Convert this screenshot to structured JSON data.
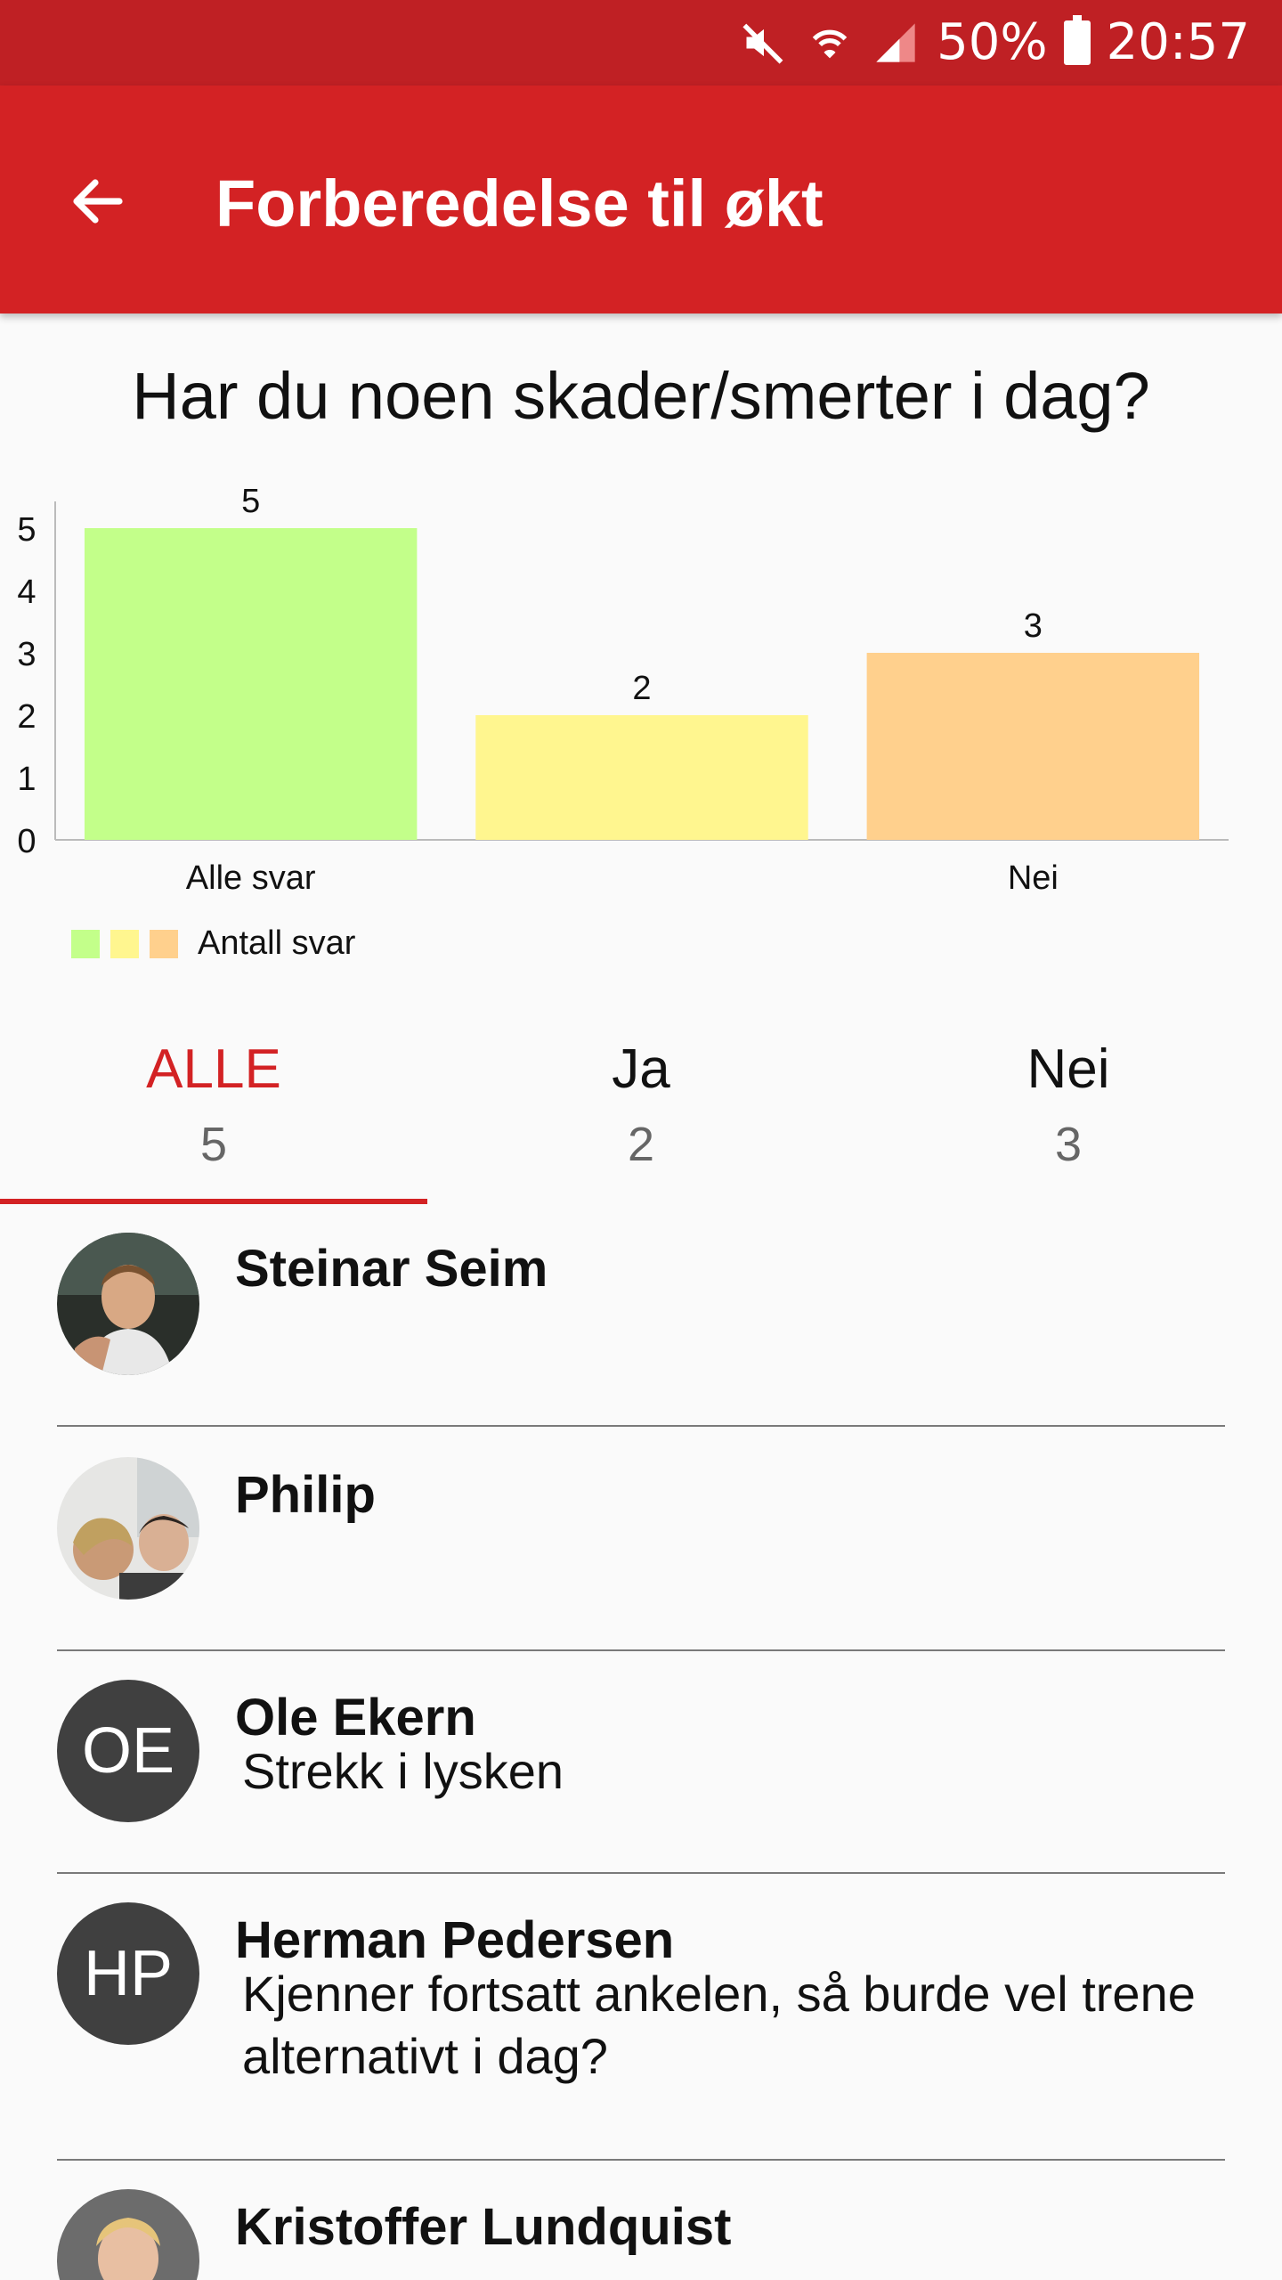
{
  "status_bar": {
    "battery": "50%",
    "time": "20:57",
    "icons": [
      "mute-icon",
      "wifi-icon",
      "signal-icon",
      "battery-icon"
    ]
  },
  "app_bar": {
    "title": "Forberedelse til økt",
    "back_icon": "arrow-left-icon"
  },
  "question": "Har du noen skader/smerter i dag?",
  "chart_data": {
    "type": "bar",
    "categories": [
      "Alle svar",
      "",
      "Nei"
    ],
    "values": [
      5,
      2,
      3
    ],
    "colors": [
      "#c3ff8a",
      "#fff68f",
      "#ffd08d"
    ],
    "ylim": [
      0,
      5
    ],
    "yticks": [
      0,
      1,
      2,
      3,
      4,
      5
    ],
    "legend": "Antall svar",
    "legend_position": "bottom-left",
    "grid": false
  },
  "tabs": [
    {
      "label": "ALLE",
      "count": "5",
      "active": true
    },
    {
      "label": "Ja",
      "count": "2",
      "active": false
    },
    {
      "label": "Nei",
      "count": "3",
      "active": false
    }
  ],
  "responses": [
    {
      "name": "Steinar Seim",
      "avatar": "photo",
      "comment": ""
    },
    {
      "name": "Philip",
      "avatar": "photo",
      "comment": ""
    },
    {
      "name": "Ole Ekern",
      "avatar": "OE",
      "comment": "Strekk i lysken"
    },
    {
      "name": "Herman Pedersen",
      "avatar": "HP",
      "comment": "Kjenner fortsatt ankelen, så burde vel trene alternativt i dag?"
    },
    {
      "name": "Kristoffer Lundquist",
      "avatar": "photo",
      "comment": ""
    }
  ],
  "colors": {
    "primary": "#d32224",
    "status_bar": "#bf2024",
    "avatar_bg": "#404040"
  }
}
